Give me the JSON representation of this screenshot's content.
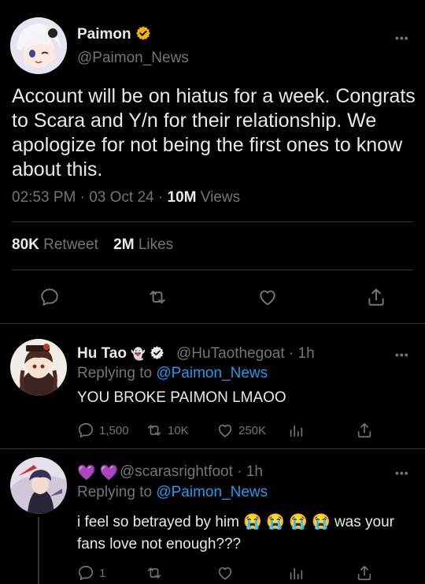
{
  "main_tweet": {
    "display_name": "Paimon",
    "handle": "@Paimon_News",
    "more": "•••",
    "text": "Account will be on hiatus for a week. Congrats to Scara and Y/n for their relationship. We apologize for not being the first ones to know about this.",
    "time": "02:53 PM",
    "date": "03 Oct 24",
    "views_count": "10M",
    "views_label": "Views",
    "retweets_count": "80K",
    "retweets_label": "Retweet",
    "likes_count": "2M",
    "likes_label": "Likes",
    "sep": "·"
  },
  "reply1": {
    "display_name": "Hu Tao",
    "emoji": "👻",
    "handle": "@HuTaothegoat",
    "age": "1h",
    "sep": "·",
    "replying_prefix": "Replying to",
    "replying_to": "@Paimon_News",
    "text": "YOU BROKE PAIMON LMAOO",
    "replies": "1,500",
    "retweets": "10K",
    "likes": "250K",
    "more": "•••"
  },
  "reply2": {
    "display_name": "💜 💜",
    "handle": "@scarasrightfoot",
    "age": "1h",
    "sep": "·",
    "replying_prefix": "Replying to",
    "replying_to": "@Paimon_News",
    "text_line1": "i feel so betrayed by him 😭 😭 😭 😭  was your",
    "text_line2": "fans love not enough???",
    "replies": "1",
    "more": "•••"
  },
  "colors": {
    "background": "#000000",
    "text_primary": "#e7e9ea",
    "text_secondary": "#71767b",
    "link": "#1d9bf0",
    "verified_badge": "#f4b400",
    "divider": "#2f3336"
  }
}
